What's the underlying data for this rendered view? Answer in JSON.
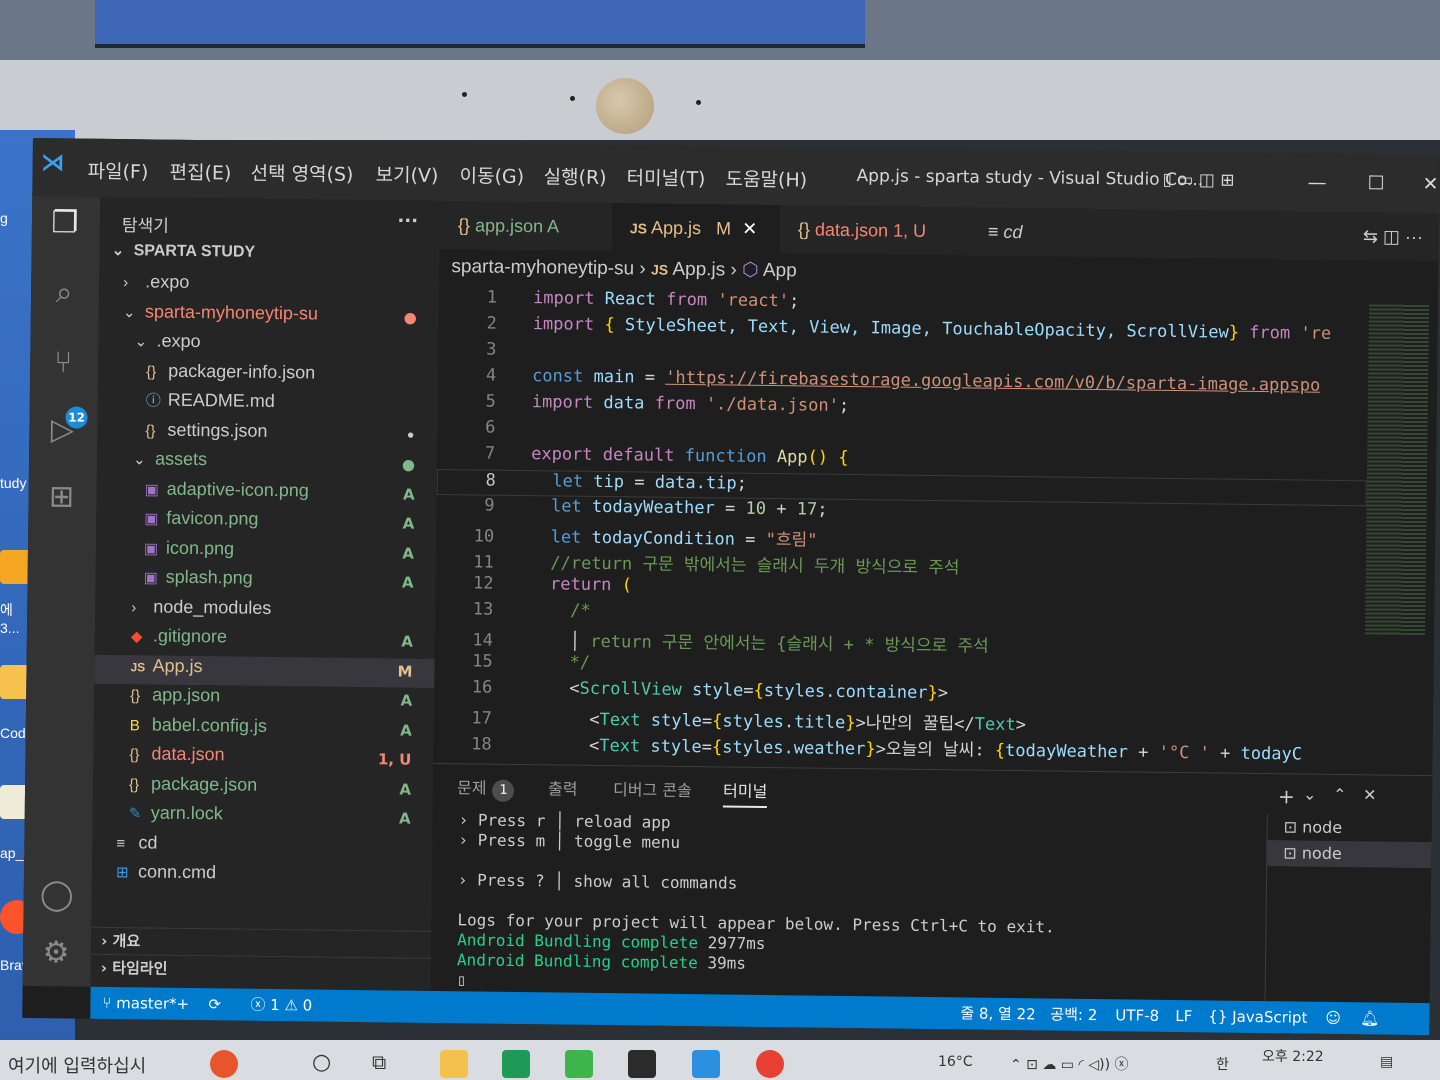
{
  "desktop": {
    "labels": [
      "g",
      "tudy",
      "에",
      "3...",
      "Codi...",
      "ap_key...",
      "Brave"
    ]
  },
  "window": {
    "title": "App.js - sparta study - Visual Studio Co...",
    "menu": [
      "파일(F)",
      "편집(E)",
      "선택 영역(S)",
      "보기(V)",
      "이동(G)",
      "실행(R)",
      "터미널(T)",
      "도움말(H)"
    ]
  },
  "activity_bar": {
    "scm_badge": "12"
  },
  "explorer": {
    "header": "탐색기",
    "more": "···",
    "root": "SPARTA STUDY",
    "items": [
      {
        "label": ".expo",
        "icon": "chevron-right",
        "indent": 1,
        "badge": "",
        "status": "folder"
      },
      {
        "label": "sparta-myhoneytip-su",
        "icon": "chevron-down",
        "indent": 1,
        "badge": "●",
        "status": "err"
      },
      {
        "label": ".expo",
        "icon": "chevron-down",
        "indent": 2,
        "badge": "",
        "status": "folder"
      },
      {
        "label": "packager-info.json",
        "icon": "json",
        "indent": 3,
        "badge": "",
        "status": "folder"
      },
      {
        "label": "README.md",
        "icon": "info",
        "indent": 3,
        "badge": "",
        "status": "folder"
      },
      {
        "label": "settings.json",
        "icon": "json",
        "indent": 3,
        "badge": "•",
        "status": "folder"
      },
      {
        "label": "assets",
        "icon": "chevron-down",
        "indent": 2,
        "badge": "●",
        "status": "add"
      },
      {
        "label": "adaptive-icon.png",
        "icon": "image",
        "indent": 3,
        "badge": "A",
        "status": "add"
      },
      {
        "label": "favicon.png",
        "icon": "image",
        "indent": 3,
        "badge": "A",
        "status": "add"
      },
      {
        "label": "icon.png",
        "icon": "image",
        "indent": 3,
        "badge": "A",
        "status": "add"
      },
      {
        "label": "splash.png",
        "icon": "image",
        "indent": 3,
        "badge": "A",
        "status": "add"
      },
      {
        "label": "node_modules",
        "icon": "chevron-right",
        "indent": 2,
        "badge": "",
        "status": "folder"
      },
      {
        "label": ".gitignore",
        "icon": "git",
        "indent": 2,
        "badge": "A",
        "status": "add"
      },
      {
        "label": "App.js",
        "icon": "js",
        "indent": 2,
        "badge": "M",
        "status": "mod",
        "selected": true
      },
      {
        "label": "app.json",
        "icon": "json",
        "indent": 2,
        "badge": "A",
        "status": "add"
      },
      {
        "label": "babel.config.js",
        "icon": "babel",
        "indent": 2,
        "badge": "A",
        "status": "add"
      },
      {
        "label": "data.json",
        "icon": "json",
        "indent": 2,
        "badge": "1, U",
        "status": "err"
      },
      {
        "label": "package.json",
        "icon": "json",
        "indent": 2,
        "badge": "A",
        "status": "add"
      },
      {
        "label": "yarn.lock",
        "icon": "yarn",
        "indent": 2,
        "badge": "A",
        "status": "add"
      },
      {
        "label": "cd",
        "icon": "lines",
        "indent": 1,
        "badge": "",
        "status": "folder"
      },
      {
        "label": "conn.cmd",
        "icon": "windows",
        "indent": 1,
        "badge": "",
        "status": "folder"
      }
    ],
    "sections": [
      "개요",
      "타임라인"
    ]
  },
  "tabs": [
    {
      "label": "app.json",
      "suffix": "A",
      "icon": "{}",
      "active": false
    },
    {
      "label": "App.js",
      "suffix": "M",
      "icon": "JS",
      "active": true,
      "close": "✕"
    },
    {
      "label": "data.json",
      "suffix": "1, U",
      "icon": "{}",
      "active": false
    },
    {
      "label": "cd",
      "suffix": "",
      "icon": "≡",
      "active": false
    }
  ],
  "breadcrumb": {
    "folder": "sparta-myhoneytip-su",
    "file": "App.js",
    "symbol": "App"
  },
  "editor": {
    "current_line": 8,
    "lines": [
      "1",
      "2",
      "3",
      "4",
      "5",
      "6",
      "7",
      "8",
      "9",
      "10",
      "11",
      "12",
      "13",
      "14",
      "15",
      "16",
      "17",
      "18"
    ],
    "code": {
      "l1_import": "import",
      "l1_react": "React",
      "l1_from": "from",
      "l1_str": "'react'",
      "l2_import": "import",
      "l2_names": "StyleSheet, Text, View, Image, TouchableOpacity, ScrollView",
      "l2_from": "from",
      "l2_str": "'re",
      "l4_const": "const",
      "l4_main": "main",
      "l4_url": "'https://firebasestorage.googleapis.com/v0/b/sparta-image.appspo",
      "l5_import": "import",
      "l5_data": "data",
      "l5_from": "from",
      "l5_str": "'./data.json'",
      "l7_export": "export",
      "l7_default": "default",
      "l7_function": "function",
      "l7_app": "App",
      "l8_let": "let",
      "l8_tip": "tip",
      "l8_rhs": "data.tip",
      "l9_let": "let",
      "l9_var": "todayWeather",
      "l9_a": "10",
      "l9_b": "17",
      "l10_let": "let",
      "l10_var": "todayCondition",
      "l10_str": "\"흐림\"",
      "l11_cmt": "//return 구문 밖에서는 슬래시 두개 방식으로 주석",
      "l12_return": "return",
      "l13_cmt": "/*",
      "l14_cmt": "return 구문 안에서는 {슬래시 + * 방식으로 주석",
      "l15_cmt": "*/",
      "l16_tag": "ScrollView",
      "l16_attr": "style",
      "l16_val": "styles.container",
      "l17_tag": "Text",
      "l17_attr": "style",
      "l17_val": "styles.title",
      "l17_text": "나만의 꿀팁",
      "l18_tag": "Text",
      "l18_attr": "style",
      "l18_val": "styles.weather",
      "l18_text": "오늘의 날씨: ",
      "l18_var": "todayWeather",
      "l18_str": "'°C '",
      "l18_tail": "todayC"
    }
  },
  "panel": {
    "tabs": {
      "problems": "문제",
      "problems_count": "1",
      "output": "출력",
      "debug": "디버그 콘솔",
      "terminal": "터미널"
    },
    "terminal_lines": {
      "t1_press": "› Press r",
      "t1_desc": "│ reload app",
      "t2_press": "› Press m",
      "t2_desc": "│ toggle menu",
      "t3_press": "› Press ?",
      "t3_desc": "│ show all commands",
      "t4": "Logs for your project will appear below. Press Ctrl+C to exit.",
      "t5_g": "Android Bundling complete",
      "t5_v": "2977ms",
      "t6_g": "Android Bundling complete",
      "t6_v": "39ms"
    },
    "terminals": [
      "node",
      "node"
    ],
    "actions": {
      "add": "+",
      "chev": "⌄",
      "max": "⌃",
      "close": "✕"
    }
  },
  "statusbar": {
    "branch": "master*+",
    "errors": "1",
    "warnings": "0",
    "position": "줄 8, 열 22",
    "spaces": "공백: 2",
    "encoding": "UTF-8",
    "eol": "LF",
    "language": "JavaScript"
  },
  "taskbar": {
    "search": "여기에 입력하십시",
    "temp": "16°C",
    "time": "오후 2:22",
    "ime": "한"
  },
  "colors": {
    "status_bar": "#007acc",
    "editor_bg": "#1e1e1e",
    "sidebar_bg": "#252526",
    "activity_bg": "#333333"
  }
}
